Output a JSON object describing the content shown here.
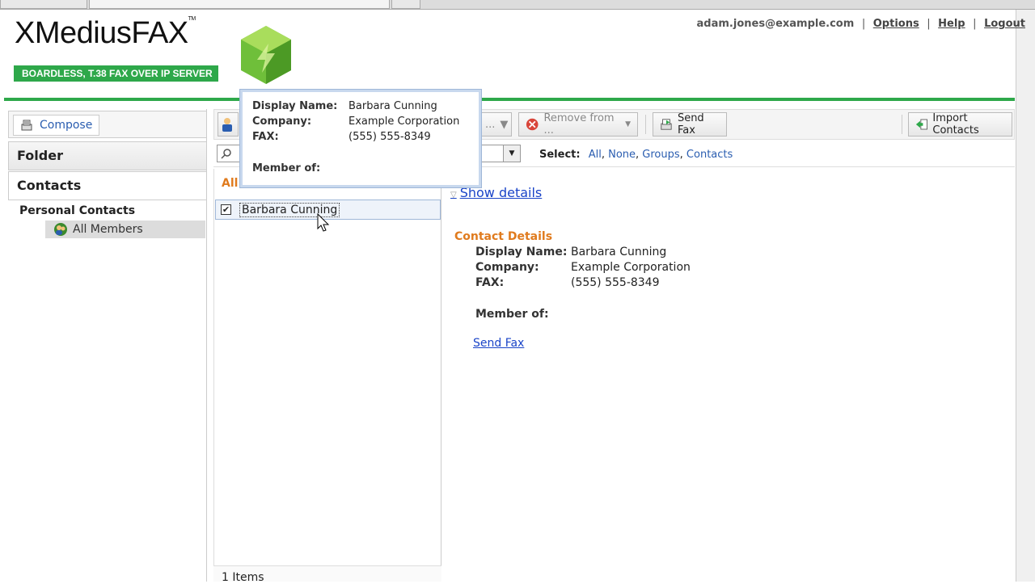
{
  "logo": {
    "title": "XMediusFAX",
    "tm": "TM",
    "tagline": "BOARDLESS, T.38 FAX OVER IP SERVER"
  },
  "header": {
    "user": "adam.jones@example.com",
    "options": "Options",
    "help": "Help",
    "logout": "Logout",
    "separator": "|"
  },
  "left": {
    "compose": "Compose",
    "folder": "Folder",
    "contacts": "Contacts",
    "tree_root": "Personal Contacts",
    "tree_item": "All Members"
  },
  "toolbar": {
    "remove_from": "Remove from ...",
    "send_fax": "Send Fax",
    "import": "Import Contacts",
    "ellipsis": "..."
  },
  "filter": {
    "select_label": "Select:",
    "options": [
      "All",
      "None",
      "Groups",
      "Contacts"
    ]
  },
  "list": {
    "title": "All",
    "rows": [
      {
        "name": "Barbara Cunning",
        "checked": true
      }
    ],
    "count": "1 Items"
  },
  "details": {
    "show_details": "Show details",
    "section": "Contact Details",
    "display_name_label": "Display Name:",
    "display_name": "Barbara Cunning",
    "company_label": "Company:",
    "company": "Example Corporation",
    "fax_label": "FAX:",
    "fax": "(555) 555-8349",
    "member_label": "Member of:",
    "send_fax": "Send Fax"
  },
  "popup": {
    "display_name_label": "Display Name:",
    "display_name": "Barbara Cunning",
    "company_label": "Company:",
    "company": "Example Corporation",
    "fax_label": "FAX:",
    "fax": "(555) 555-8349",
    "member_label": "Member of:"
  },
  "colors": {
    "brand_green": "#2ea84a",
    "accent_orange": "#e07b1e",
    "link_blue": "#1a44c8"
  }
}
